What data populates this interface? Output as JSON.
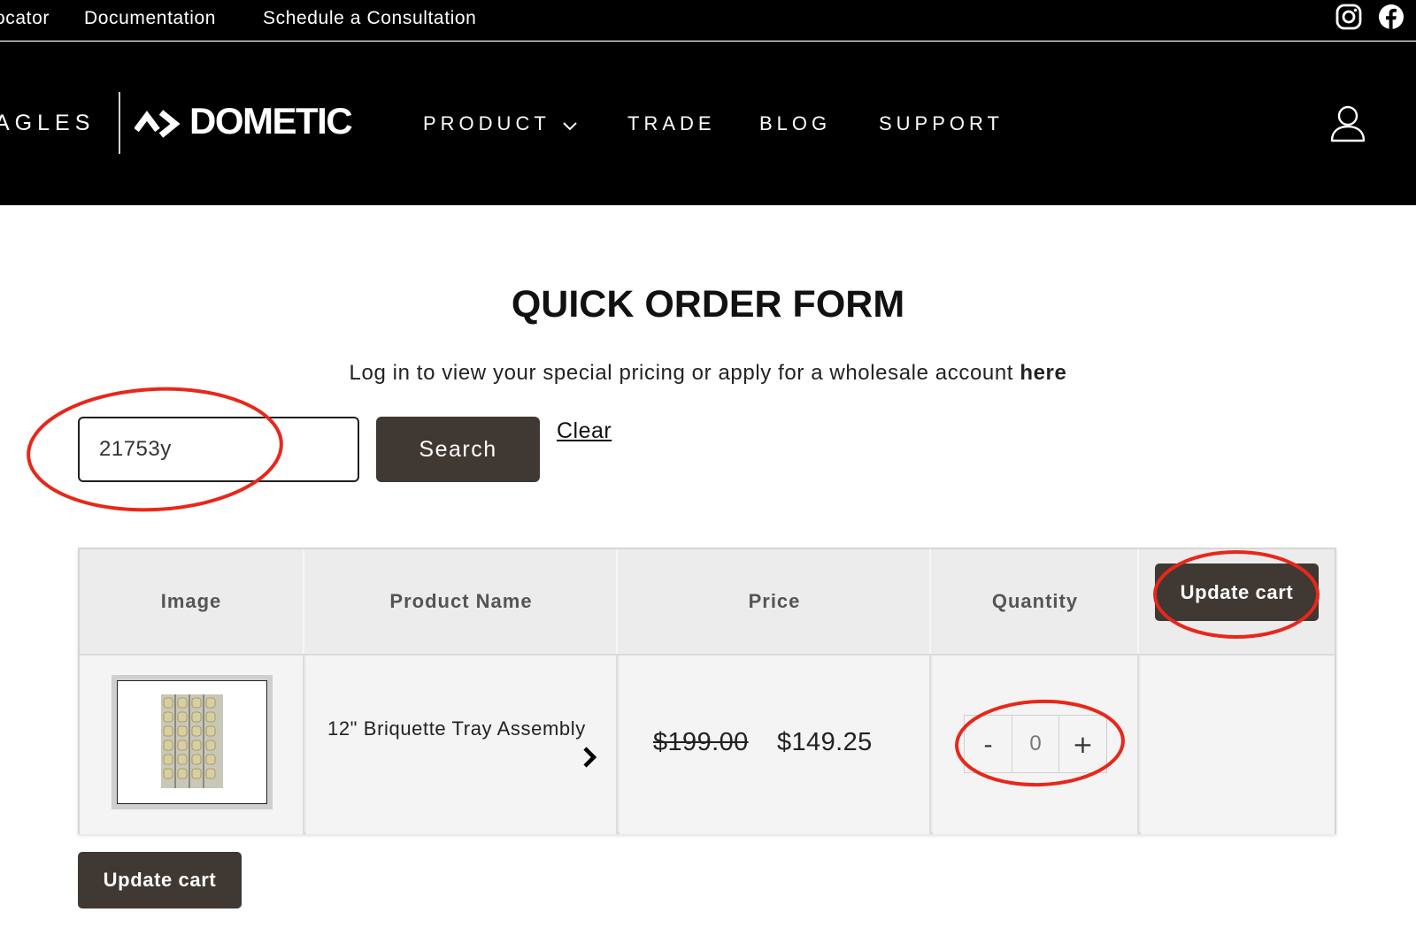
{
  "utility_bar": {
    "links": [
      "ocator",
      "Documentation",
      "Schedule a Consultation"
    ],
    "icons": [
      "instagram-icon",
      "facebook-icon"
    ]
  },
  "header": {
    "brand_left": "AGLES",
    "brand_right": "DOMETIC",
    "nav": {
      "product": "PRODUCT",
      "trade": "TRADE",
      "blog": "BLOG",
      "support": "SUPPORT"
    },
    "icons": [
      "chevron-down-icon",
      "account-icon"
    ]
  },
  "main": {
    "title": "QUICK ORDER FORM",
    "login_note": "Log in to view your special pricing or apply for a wholesale account ",
    "login_link": "here",
    "search": {
      "value": "21753y",
      "button": "Search",
      "clear": "Clear"
    }
  },
  "table": {
    "headers": [
      "Image",
      "Product Name",
      "Price",
      "Quantity"
    ],
    "update_cart_label": "Update cart",
    "rows": [
      {
        "name": "12\" Briquette Tray Assembly",
        "price_original": "$199.00",
        "price_sale": "$149.25",
        "quantity": "0",
        "minus": "-",
        "plus": "+"
      }
    ]
  },
  "footer_actions": {
    "update_cart_label": "Update cart"
  },
  "colors": {
    "header_bg": "#000000",
    "button_bg": "#3f3833",
    "annotation_red": "#e8271b",
    "table_bg": "#ececec"
  }
}
